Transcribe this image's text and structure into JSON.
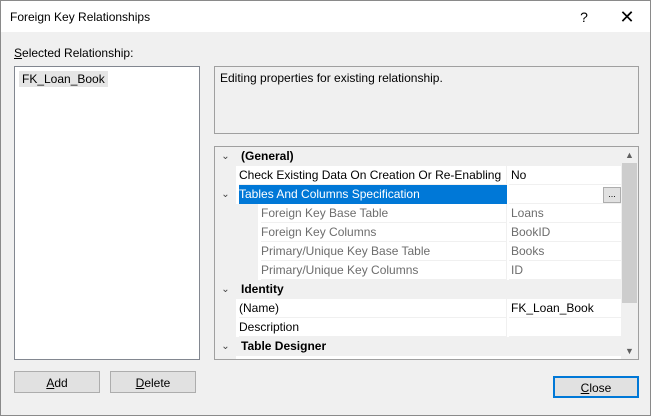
{
  "window": {
    "title": "Foreign Key Relationships",
    "help_glyph": "?",
    "close_glyph": "✕"
  },
  "relationships": {
    "label_underlined": "S",
    "label_rest": "elected Relationship:",
    "items": [
      "FK_Loan_Book"
    ]
  },
  "description": "Editing properties for existing relationship.",
  "grid": {
    "rows": [
      {
        "type": "category",
        "expander": "⌄",
        "name": "(General)"
      },
      {
        "type": "prop",
        "name": "Check Existing Data On Creation Or Re-Enabling",
        "value": "No"
      },
      {
        "type": "prop-selected",
        "expander": "⌄",
        "name": "Tables And Columns Specification",
        "value": "",
        "button": "..."
      },
      {
        "type": "sub",
        "name": "Foreign Key Base Table",
        "value": "Loans"
      },
      {
        "type": "sub",
        "name": "Foreign Key Columns",
        "value": "BookID"
      },
      {
        "type": "sub",
        "name": "Primary/Unique Key Base Table",
        "value": "Books"
      },
      {
        "type": "sub",
        "name": "Primary/Unique Key Columns",
        "value": "ID"
      },
      {
        "type": "category",
        "expander": "⌄",
        "name": "Identity"
      },
      {
        "type": "prop",
        "name": "(Name)",
        "value": "FK_Loan_Book"
      },
      {
        "type": "prop",
        "name": "Description",
        "value": ""
      },
      {
        "type": "category",
        "expander": "⌄",
        "name": "Table Designer"
      }
    ],
    "scroll_up_glyph": "▲",
    "scroll_down_glyph": "▼"
  },
  "buttons": {
    "add_u": "A",
    "add_rest": "dd",
    "delete_u": "D",
    "delete_rest": "elete",
    "close_u": "C",
    "close_rest": "lose"
  }
}
